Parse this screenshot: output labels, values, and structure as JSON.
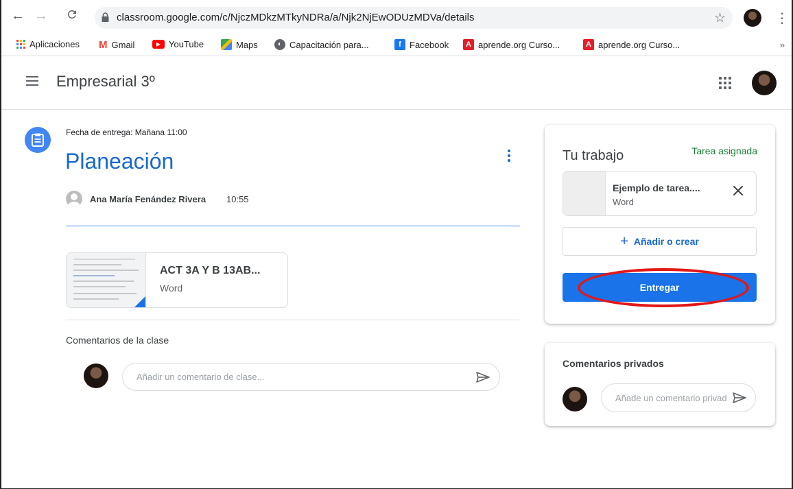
{
  "browser": {
    "url": "classroom.google.com/c/NjczMDkzMTkyNDRa/a/Njk2NjEwODUzMDVa/details",
    "back_icon": "arrow-left-icon",
    "forward_icon": "arrow-right-icon",
    "reload_icon": "reload-icon",
    "bookmark_icon": "star-icon"
  },
  "bookmarks": {
    "items": [
      {
        "label": "Aplicaciones",
        "icon": "apps-icon",
        "color": "#4285f4"
      },
      {
        "label": "Gmail",
        "icon": "gmail-icon",
        "color": "#ea4335"
      },
      {
        "label": "YouTube",
        "icon": "youtube-icon",
        "color": "#ff0000"
      },
      {
        "label": "Maps",
        "icon": "maps-icon",
        "color": "#34a853"
      },
      {
        "label": "Capacitación para...",
        "icon": "globe-icon",
        "color": "#5f6368"
      },
      {
        "label": "Facebook",
        "icon": "facebook-icon",
        "color": "#1877f2"
      },
      {
        "label": "aprende.org Curso...",
        "icon": "aprende-icon",
        "color": "#e21e26"
      },
      {
        "label": "aprende.org Curso...",
        "icon": "aprende-icon",
        "color": "#e21e26"
      }
    ],
    "more": "»"
  },
  "header": {
    "class_name": "Empresarial 3º"
  },
  "assignment": {
    "due": "Fecha de entrega: Mañana 11:00",
    "title": "Planeación",
    "author": "Ana María Fenández Rivera",
    "time": "10:55",
    "attachment": {
      "title": "ACT 3A Y B 13AB...",
      "type": "Word"
    }
  },
  "class_comments": {
    "label": "Comentarios de la clase",
    "placeholder": "Añadir un comentario de clase..."
  },
  "your_work": {
    "title": "Tu trabajo",
    "status": "Tarea asignada",
    "status_color": "#188038",
    "file": {
      "name": "Ejemplo de tarea....",
      "type": "Word"
    },
    "add_label": "Añadir o crear",
    "submit_label": "Entregar",
    "accent": "#1a73e8",
    "highlight_color": "#e21818"
  },
  "private_comments": {
    "label": "Comentarios privados",
    "placeholder": "Añade un comentario privado..."
  }
}
